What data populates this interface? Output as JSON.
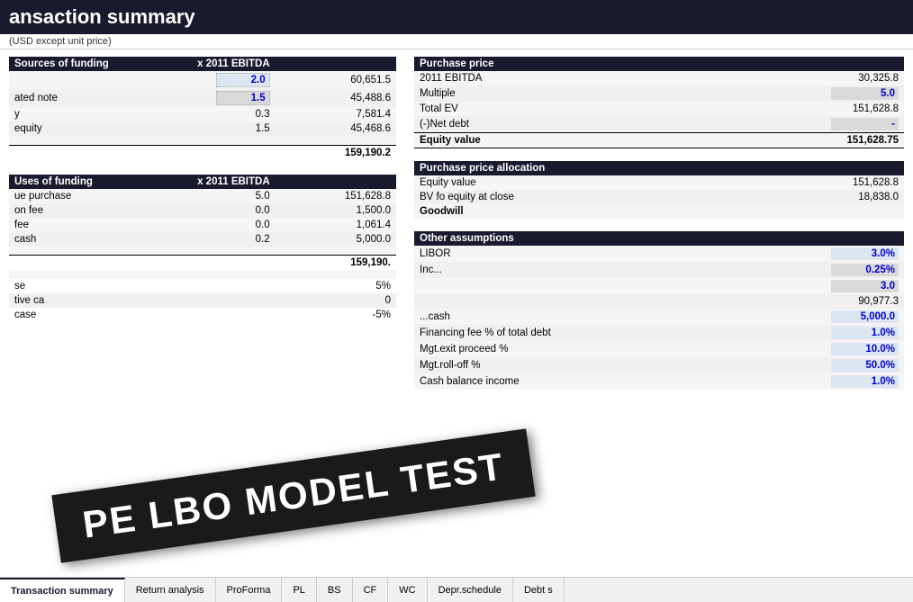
{
  "header": {
    "title": "ansaction summary",
    "subtitle": "(USD except unit price)"
  },
  "left_panel": {
    "sources_header": "Sources of funding",
    "sources_col1": "x 2011 EBITDA",
    "sources_rows": [
      {
        "label": "",
        "multiple": "2.0",
        "value": "60,651.5",
        "input_type": "blue"
      },
      {
        "label": "ated note",
        "multiple": "1.5",
        "value": "45,488.6",
        "input_type": "gray"
      },
      {
        "label": "y",
        "multiple": "0.3",
        "value": "7,581.4",
        "input_type": "none"
      },
      {
        "label": "equity",
        "multiple": "1.5",
        "value": "45,468.6",
        "input_type": "none"
      }
    ],
    "sources_total": "159,190.2",
    "uses_header": "Uses of funding",
    "uses_col1": "x 2011 EBITDA",
    "uses_rows": [
      {
        "label": "ue purchase",
        "multiple": "5.0",
        "value": "151,628.8"
      },
      {
        "label": "on fee",
        "multiple": "0.0",
        "value": "1,500.0"
      },
      {
        "label": "fee",
        "multiple": "0.0",
        "value": "1,061.4"
      },
      {
        "label": "cash",
        "multiple": "0.2",
        "value": "5,000.0"
      }
    ],
    "uses_total": "159,190."
  },
  "right_panel": {
    "purchase_price_header": "Purchase price",
    "purchase_price_rows": [
      {
        "label": "2011 EBITDA",
        "value": "30,325.8"
      },
      {
        "label": "Multiple",
        "input_value": "5.0",
        "input_type": "gray"
      },
      {
        "label": "Total EV",
        "value": "151,628.8"
      },
      {
        "label": "(-)Net debt",
        "input_value": "-",
        "input_type": "gray"
      }
    ],
    "equity_value_label": "Equity value",
    "equity_value": "151,628.75",
    "ppa_header": "Purchase price allocation",
    "ppa_rows": [
      {
        "label": "Equity value",
        "value": "151,628.8"
      },
      {
        "label": "BV fo equity at close",
        "value": "18,838.0"
      },
      {
        "label": "Goodwill",
        "value": ""
      }
    ],
    "other_header": "Other assumptions",
    "other_rows": [
      {
        "label": "LIBOR",
        "input_value": "3.0%",
        "input_type": "blue"
      },
      {
        "label": "Inc...",
        "input_value": "0.25%",
        "input_type": "gray"
      },
      {
        "label": "",
        "input_value": "3.0",
        "input_type": "gray"
      },
      {
        "label": "",
        "value": "90,977.3"
      },
      {
        "label": "...cash",
        "input_value": "5,000.0",
        "input_type": "blue"
      },
      {
        "label": "Financing fee % of total debt",
        "input_value": "1.0%",
        "input_type": "blue"
      },
      {
        "label": "Mgt.exit proceed %",
        "input_value": "10.0%",
        "input_type": "blue"
      },
      {
        "label": "Mgt.roll-off %",
        "input_value": "50.0%",
        "input_type": "blue"
      },
      {
        "label": "Cash balance income",
        "input_value": "1.0%",
        "input_type": "blue"
      }
    ],
    "case_rows": [
      {
        "label": "se",
        "value": "5%"
      },
      {
        "label": "tive ca",
        "value": "0"
      },
      {
        "label": "case",
        "value": "-5%"
      }
    ]
  },
  "tabs": [
    {
      "label": "Transaction summary",
      "active": true
    },
    {
      "label": "Return analysis",
      "active": false
    },
    {
      "label": "ProForma",
      "active": false
    },
    {
      "label": "PL",
      "active": false
    },
    {
      "label": "BS",
      "active": false
    },
    {
      "label": "CF",
      "active": false
    },
    {
      "label": "WC",
      "active": false
    },
    {
      "label": "Depr.schedule",
      "active": false
    },
    {
      "label": "Debt s",
      "active": false
    }
  ],
  "watermark": {
    "text": "PE LBO MODEL TEST"
  }
}
